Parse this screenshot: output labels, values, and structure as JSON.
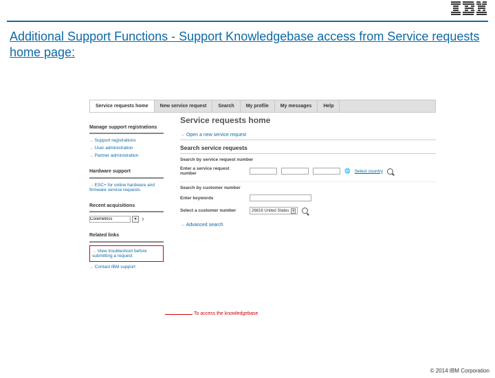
{
  "slide_title": "Additional Support Functions - Support Knowledgebase access from Service requests home page:",
  "tabs": [
    "Service requests home",
    "New service request",
    "Search",
    "My profile",
    "My messages",
    "Help"
  ],
  "page_heading": "Service requests home",
  "open_new": "Open a new service request",
  "search_heading": "Search service requests",
  "by_num_label": "Search by service request number",
  "enter_req_label": "Enter a service request number",
  "select_country": "Select country",
  "by_cust_label": "Search by customer number",
  "enter_kw_label": "Enter keywords",
  "select_cust_label": "Select a customer number",
  "cust_value": "26816",
  "cust_country": "United States",
  "advanced": "Advanced search",
  "sidebar": {
    "manage_head": "Manage support registrations",
    "manage_links": [
      "Support registrations",
      "User administration",
      "Partner administration"
    ],
    "hw_head": "Hardware support",
    "hw_links": [
      "ESC+ for online hardware and firmware service requests"
    ],
    "recent_head": "Recent acquisitions",
    "recent_item": "Coremetrics",
    "related_head": "Related links",
    "related1": "View troubleshoot before submitting a request",
    "related2": "Contact IBM support"
  },
  "annotation": "To access the knowledgebase",
  "copyright": "© 2014 IBM Corporation"
}
